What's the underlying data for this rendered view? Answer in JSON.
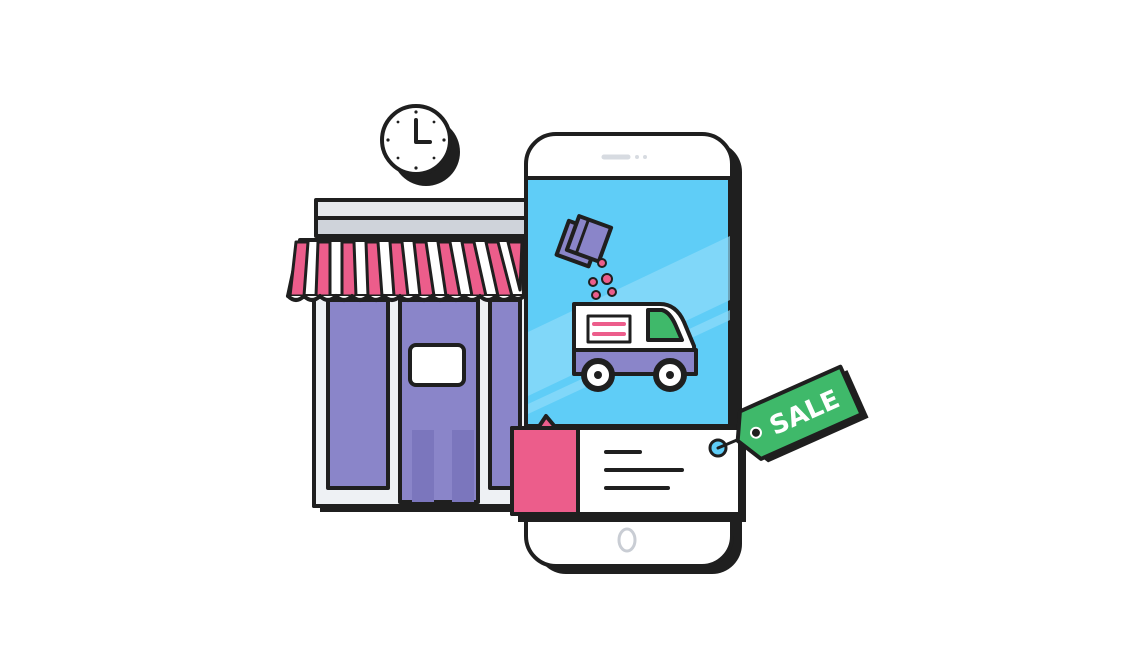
{
  "illustration": {
    "sale_tag": {
      "label": "SALE"
    }
  },
  "colors": {
    "outline": "#1f1f1f",
    "shop_wall": "#eef1f4",
    "shop_door": "#8a85c9",
    "awning_pink": "#ec5d8b",
    "phone_screen": "#5fcdf7",
    "card_pink": "#ec5d8b",
    "tag_green": "#3fb96a",
    "van_green": "#3fb96a",
    "clock_face": "#ffffff"
  }
}
